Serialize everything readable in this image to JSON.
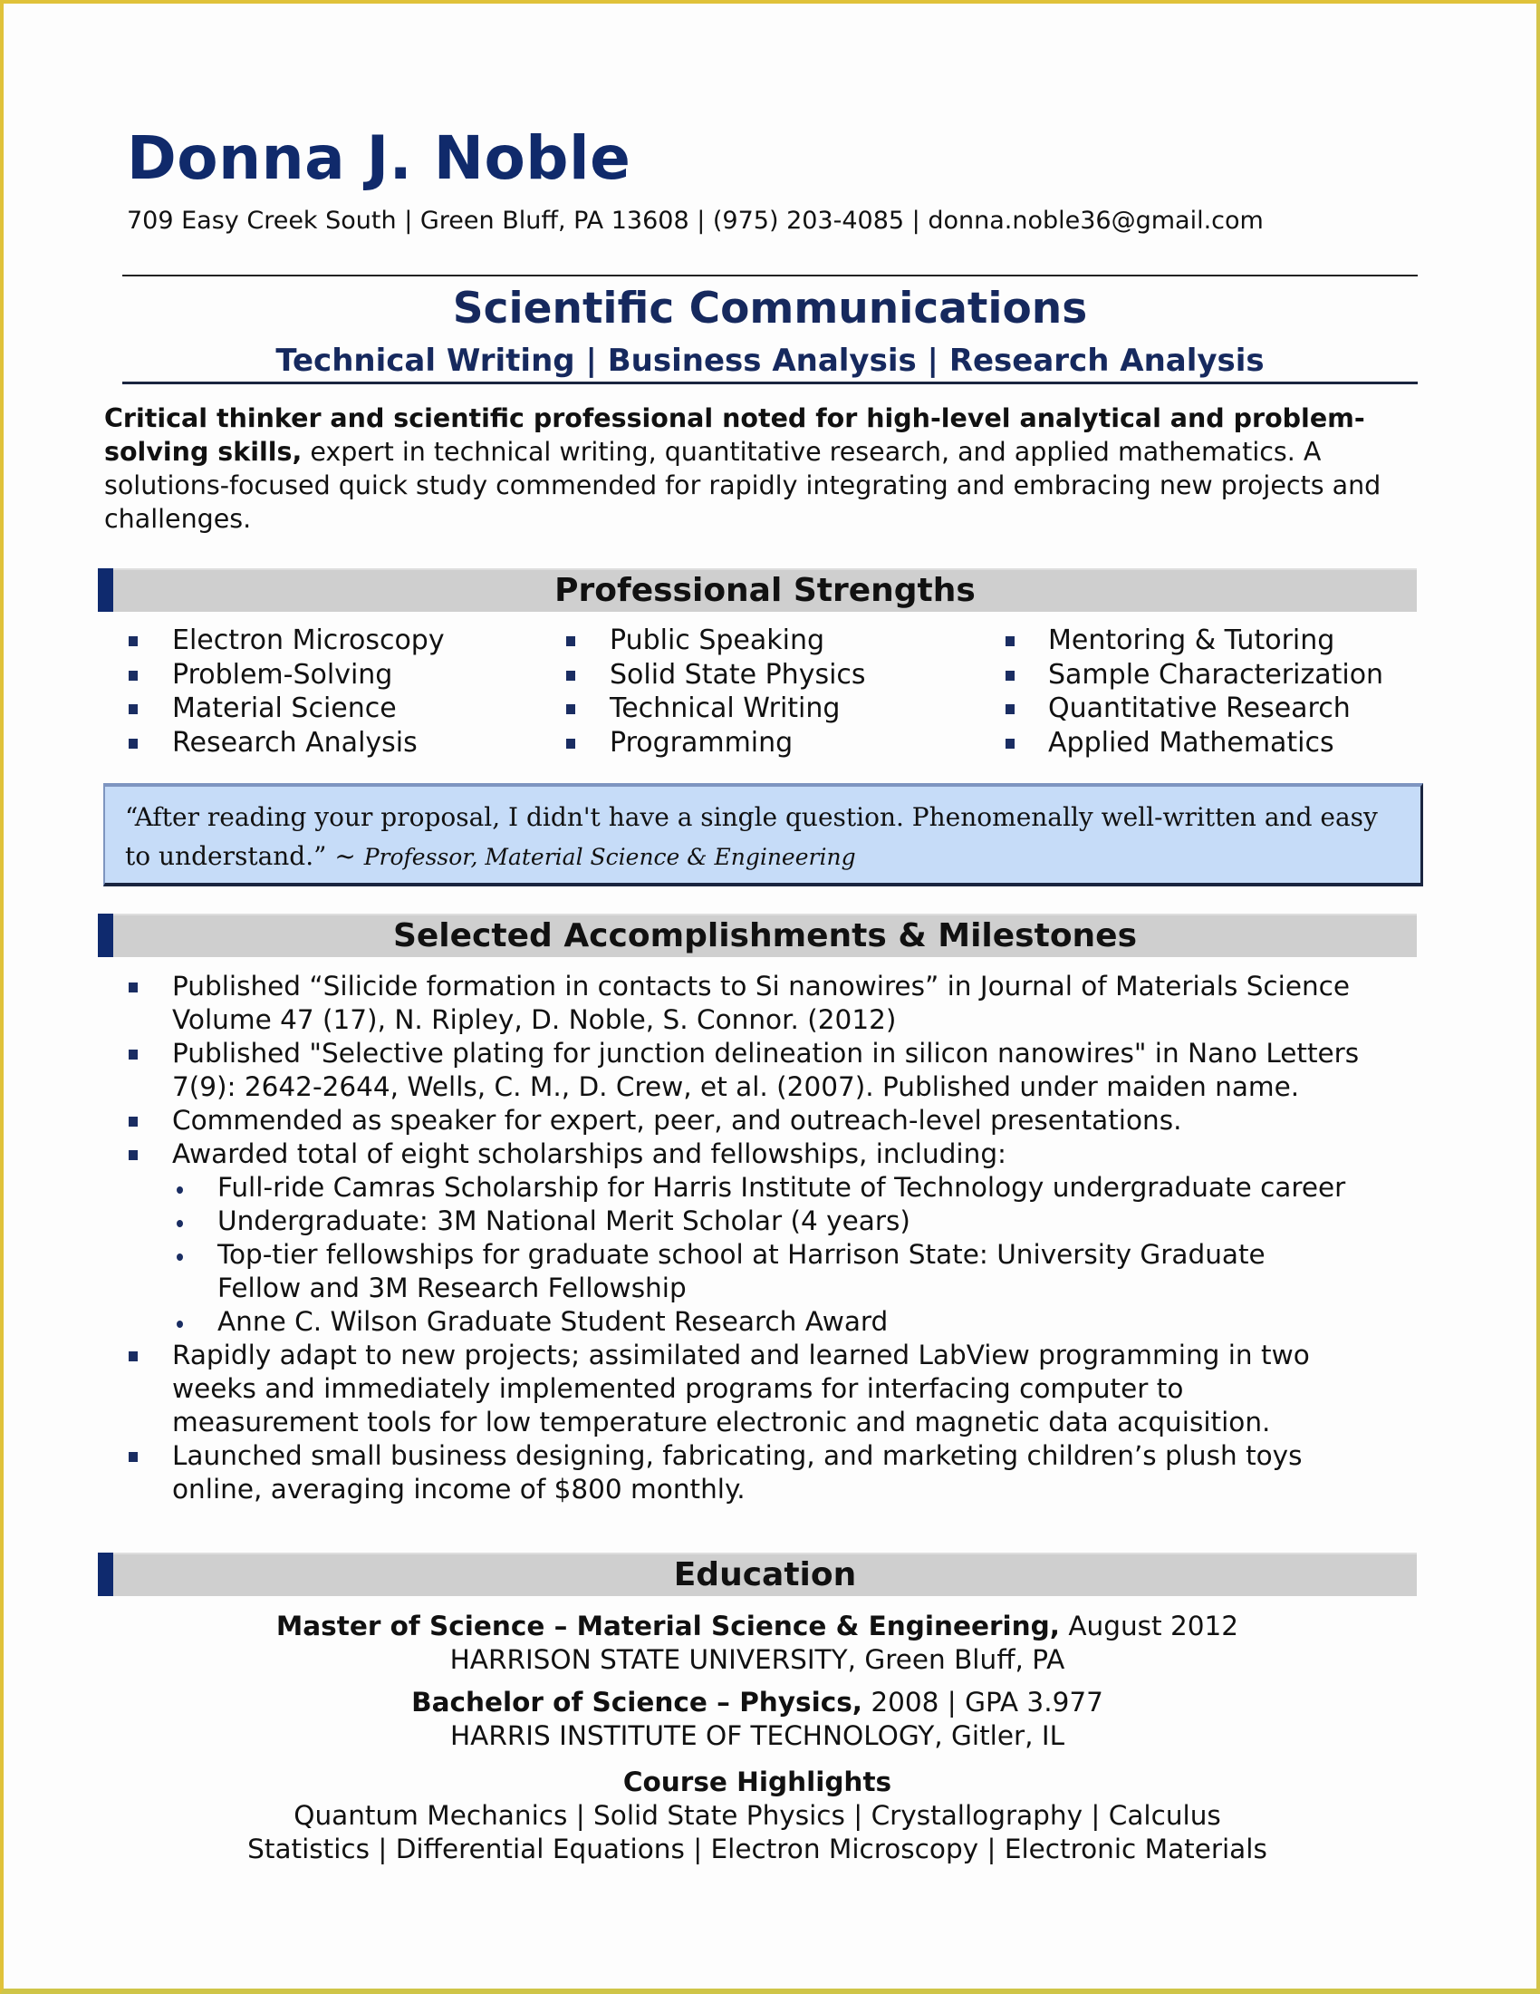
{
  "header": {
    "name": "Donna J. Noble",
    "contact": "709 Easy Creek South | Green Bluff, PA  13608 | (975) 203-4085 | donna.noble36@gmail.com",
    "headline": "Scientific Communications",
    "subheadline": "Technical Writing | Business Analysis | Research Analysis"
  },
  "summary": {
    "bold_lead": "Critical thinker and scientific professional noted for high-level analytical and problem-solving skills,",
    "rest": " expert in technical writing, quantitative research, and applied mathematics. A solutions-focused quick study commended for rapidly integrating and embracing new projects and challenges."
  },
  "sections": {
    "strengths": "Professional Strengths",
    "accomplishments": "Selected Accomplishments & Milestones",
    "education": "Education"
  },
  "strengths": [
    [
      "Electron Microscopy",
      "Problem-Solving",
      "Material Science",
      "Research Analysis"
    ],
    [
      "Public Speaking",
      "Solid State Physics",
      "Technical Writing",
      "Programming"
    ],
    [
      "Mentoring & Tutoring",
      "Sample Characterization",
      "Quantitative Research",
      "Applied Mathematics"
    ]
  ],
  "quote": {
    "line1": "“After reading your proposal, I didn't have a single question.  Phenomenally well-written and easy",
    "line2": "to understand.”  ~ ",
    "attribution": "Professor, Material Science & Engineering"
  },
  "accomplishments": [
    {
      "lines": [
        "Published “Silicide formation in contacts to Si nanowires” in Journal of Materials Science",
        "Volume 47 (17), N. Ripley, D. Noble, S. Connor. (2012)"
      ]
    },
    {
      "lines": [
        "Published \"Selective plating for junction delineation in silicon nanowires\" in Nano Letters",
        "7(9): 2642-2644, Wells, C. M., D. Crew, et al. (2007). Published under maiden name."
      ]
    },
    {
      "lines": [
        "Commended as speaker for expert, peer, and outreach-level presentations."
      ]
    },
    {
      "lines": [
        "Awarded total of eight scholarships and fellowships, including:"
      ],
      "sub": [
        {
          "lines": [
            "Full-ride Camras Scholarship for Harris Institute of Technology undergraduate career"
          ]
        },
        {
          "lines": [
            "Undergraduate: 3M National Merit Scholar (4 years)"
          ]
        },
        {
          "lines": [
            "Top-tier fellowships for graduate school at Harrison State: University Graduate",
            "Fellow and 3M Research Fellowship"
          ]
        },
        {
          "lines": [
            "Anne C. Wilson Graduate Student Research Award"
          ]
        }
      ]
    },
    {
      "lines": [
        "Rapidly adapt to new projects; assimilated and learned LabView programming in two",
        "weeks and immediately implemented programs for interfacing computer to",
        "measurement tools for low temperature electronic and magnetic data acquisition."
      ]
    },
    {
      "lines": [
        "Launched small business designing, fabricating, and marketing children’s plush toys",
        "online, averaging income of $800 monthly."
      ]
    }
  ],
  "education": {
    "degrees": [
      {
        "degree": "Master of Science – Material Science & Engineering,",
        "detail": " August 2012",
        "school": "HARRISON STATE UNIVERSITY, Green Bluff, PA"
      },
      {
        "degree": "Bachelor of Science – Physics,",
        "detail": " 2008 | GPA 3.977",
        "school": "HARRIS INSTITUTE OF TECHNOLOGY, Gitler, IL"
      }
    ],
    "courses_title": "Course Highlights",
    "courses_line1": "Quantum Mechanics | Solid State Physics | Crystallography | Calculus",
    "courses_line2": "Statistics | Differential Equations | Electron Microscopy | Electronic Materials"
  },
  "colors": {
    "accent_navy": "#102a6b",
    "section_bar_gray": "#cfcfcf",
    "quote_box_blue": "#c6dcf8",
    "frame_yellow": "#e0c23a"
  }
}
